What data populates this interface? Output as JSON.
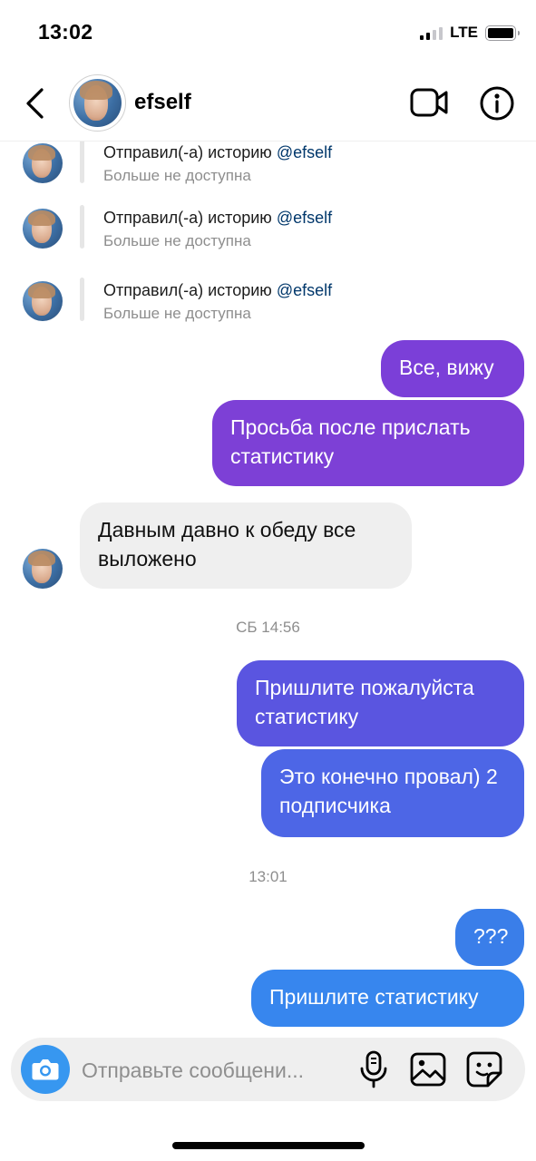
{
  "status_bar": {
    "time": "13:02",
    "network": "LTE"
  },
  "header": {
    "username": "efself"
  },
  "story_replies": [
    {
      "line1": "Отправил(-а) историю ",
      "mention": "@efself",
      "line2": "Больше не доступна"
    },
    {
      "line1": "Отправил(-а) историю ",
      "mention": "@efself",
      "line2": "Больше не доступна"
    },
    {
      "line1": "Отправил(-а) историю ",
      "mention": "@efself",
      "line2": "Больше не доступна"
    }
  ],
  "messages": [
    {
      "direction": "out",
      "text": "Все, вижу",
      "color": "#7b3fd8"
    },
    {
      "direction": "out",
      "text": "Просьба после прислать статистику",
      "color": "#7d40d6"
    },
    {
      "direction": "in",
      "text": "Давным давно к обеду все выложено",
      "color": "#efefef"
    },
    {
      "direction": "out",
      "text": "Пришлите пожалуйста статистику",
      "color": "#5a55e0"
    },
    {
      "direction": "out",
      "text": "Это конечно провал) 2 подписчика",
      "color": "#4d66e6"
    },
    {
      "direction": "out",
      "text": "???",
      "color": "#3a7ee9"
    },
    {
      "direction": "out",
      "text": "Пришлите статистику",
      "color": "#3786ee"
    }
  ],
  "timestamps": [
    "СБ 14:56",
    "13:01"
  ],
  "composer": {
    "placeholder": "Отправьте сообщени..."
  },
  "colors": {
    "accent_blue": "#3797f0",
    "mention": "#00376b",
    "secondary_text": "#8e8e8e",
    "incoming_bubble": "#efefef"
  },
  "icons": [
    "back-chevron-icon",
    "video-camera-icon",
    "info-icon",
    "camera-icon",
    "microphone-icon",
    "gallery-icon",
    "sticker-icon"
  ]
}
